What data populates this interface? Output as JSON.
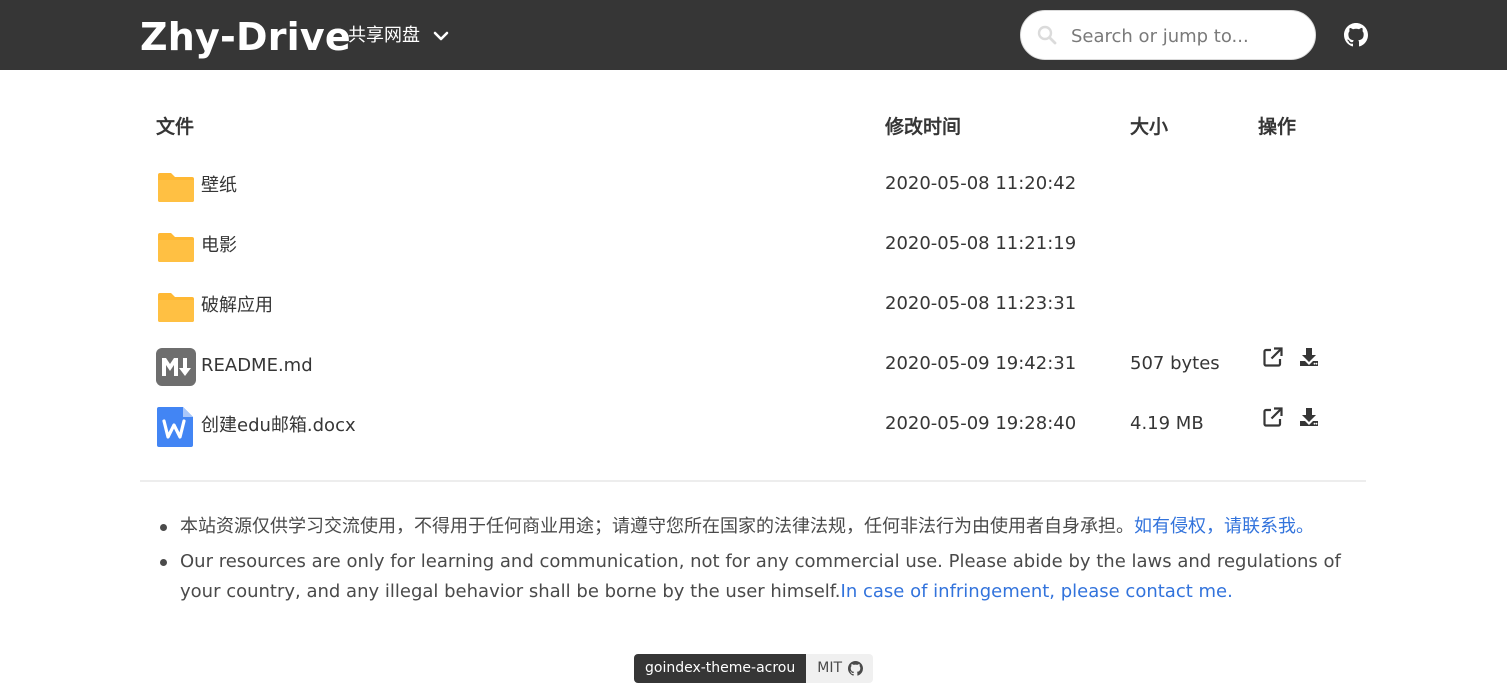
{
  "navbar": {
    "brand": "Zhy-Drive",
    "drive_label": "共享网盘",
    "search_placeholder": "Search or jump to..."
  },
  "table": {
    "headers": {
      "name": "文件",
      "modified": "修改时间",
      "size": "大小",
      "actions": "操作"
    },
    "rows": [
      {
        "name": "壁纸",
        "modified": "2020-05-08 11:20:42",
        "size": "",
        "icon": "folder-icon"
      },
      {
        "name": "电影",
        "modified": "2020-05-08 11:21:19",
        "size": "",
        "icon": "folder-icon"
      },
      {
        "name": "破解应用",
        "modified": "2020-05-08 11:23:31",
        "size": "",
        "icon": "folder-icon"
      },
      {
        "name": "README.md",
        "modified": "2020-05-09 19:42:31",
        "size": "507 bytes",
        "icon": "markdown-icon"
      },
      {
        "name": "创建edu邮箱.docx",
        "modified": "2020-05-09 19:28:40",
        "size": "4.19 MB",
        "icon": "word-doc-icon"
      }
    ]
  },
  "notice": {
    "zh_text": "本站资源仅供学习交流使用，不得用于任何商业用途；请遵守您所在国家的法律法规，任何非法行为由使用者自身承担。",
    "zh_link": "如有侵权，请联系我。",
    "en_text": "Our resources are only for learning and communication, not for any commercial use. Please abide by the laws and regulations of your country, and any illegal behavior shall be borne by the user himself.",
    "en_link": "In case of infringement, please contact me."
  },
  "footer": {
    "theme_name": "goindex-theme-acrou",
    "license": "MIT"
  },
  "colors": {
    "navbar_bg": "#363636",
    "folder": "#FFB833",
    "link": "#3273dc",
    "word_blue": "#4285F4",
    "markdown_gray": "#6e6e6e"
  }
}
